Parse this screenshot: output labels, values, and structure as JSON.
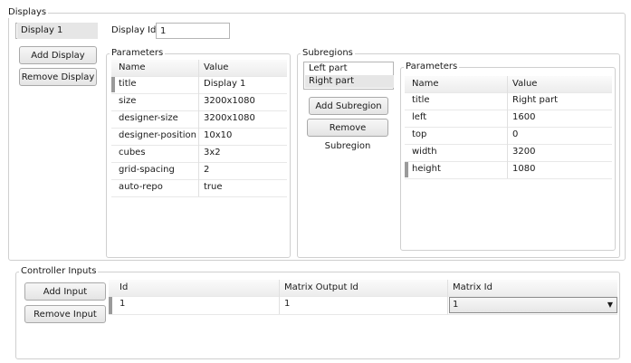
{
  "displays": {
    "legend": "Displays",
    "list": [
      "Display 1"
    ],
    "id_label": "Display Id:",
    "id_value": "1",
    "add_button": "Add Display",
    "remove_button": "Remove Display"
  },
  "parameters": {
    "legend": "Parameters",
    "columns": [
      "Name",
      "Value"
    ],
    "rows": [
      {
        "name": "title",
        "value": "Display 1"
      },
      {
        "name": "size",
        "value": "3200x1080"
      },
      {
        "name": "designer-size",
        "value": "3200x1080"
      },
      {
        "name": "designer-position",
        "value": "10x10"
      },
      {
        "name": "cubes",
        "value": "3x2"
      },
      {
        "name": "grid-spacing",
        "value": "2"
      },
      {
        "name": "auto-repo",
        "value": "true"
      }
    ]
  },
  "subregions": {
    "legend": "Subregions",
    "list": [
      "Left part",
      "Right part"
    ],
    "add_button": "Add Subregion",
    "remove_button": "Remove Subregion",
    "parameters": {
      "legend": "Parameters",
      "columns": [
        "Name",
        "Value"
      ],
      "rows": [
        {
          "name": "title",
          "value": "Right part"
        },
        {
          "name": "left",
          "value": "1600"
        },
        {
          "name": "top",
          "value": "0"
        },
        {
          "name": "width",
          "value": "3200"
        },
        {
          "name": "height",
          "value": "1080"
        }
      ]
    }
  },
  "controller_inputs": {
    "legend": "Controller Inputs",
    "add_button": "Add Input",
    "remove_button": "Remove Input",
    "columns": [
      "Id",
      "Matrix Output Id",
      "Matrix Id"
    ],
    "rows": [
      {
        "id": "1",
        "matrix_output_id": "1",
        "matrix_id": "1"
      }
    ],
    "dropdown_icon": "chevron-down-icon"
  }
}
